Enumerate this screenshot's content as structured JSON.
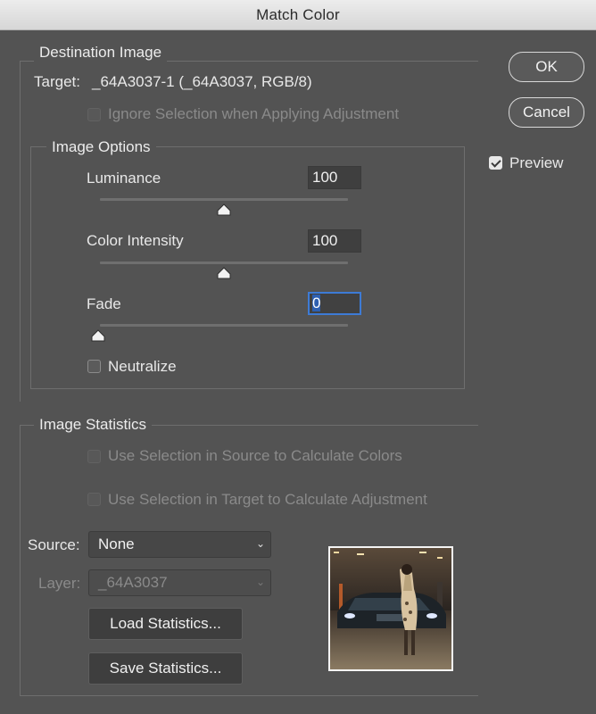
{
  "window": {
    "title": "Match Color"
  },
  "buttons": {
    "ok": "OK",
    "cancel": "Cancel"
  },
  "preview": {
    "label": "Preview",
    "checked": true
  },
  "destination": {
    "section_title": "Destination Image",
    "target_label": "Target:",
    "target_value": "_64A3037-1 (_64A3037, RGB/8)",
    "ignore_selection_label": "Ignore Selection when Applying Adjustment"
  },
  "image_options": {
    "section_title": "Image Options",
    "luminance": {
      "label": "Luminance",
      "value": "100",
      "level": 0.5
    },
    "color_intensity": {
      "label": "Color Intensity",
      "value": "100",
      "level": 0.5
    },
    "fade": {
      "label": "Fade",
      "value": "0",
      "level": 0.0
    },
    "neutralize_label": "Neutralize"
  },
  "image_statistics": {
    "section_title": "Image Statistics",
    "use_selection_source_label": "Use Selection in Source to Calculate Colors",
    "use_selection_target_label": "Use Selection in Target to Calculate Adjustment",
    "source_label": "Source:",
    "source_value": "None",
    "layer_label": "Layer:",
    "layer_value": "_64A3037",
    "load_label": "Load Statistics...",
    "save_label": "Save Statistics..."
  },
  "colors": {
    "dialog_bg": "#535353",
    "focus_ring": "#3d7bd6"
  }
}
